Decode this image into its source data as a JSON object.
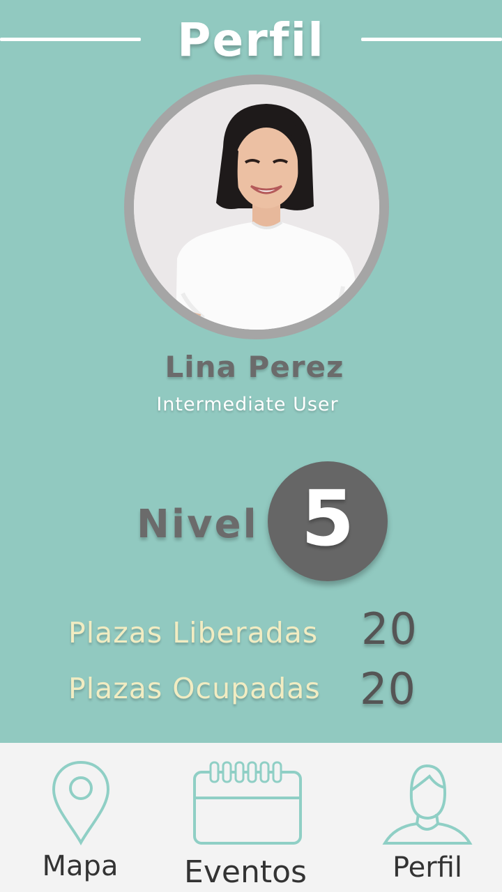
{
  "header": {
    "title": "Perfil"
  },
  "profile": {
    "name": "Lina Perez",
    "role": "Intermediate User"
  },
  "level": {
    "label": "Nivel",
    "value": "5"
  },
  "stats": [
    {
      "label": "Plazas Liberadas",
      "value": "20"
    },
    {
      "label": "Plazas Ocupadas",
      "value": "20"
    }
  ],
  "nav": {
    "items": [
      {
        "label": "Mapa",
        "icon": "map-pin-icon"
      },
      {
        "label": "Eventos",
        "icon": "calendar-icon"
      },
      {
        "label": "Perfil",
        "icon": "user-icon"
      }
    ]
  },
  "colors": {
    "background": "#91c9c0",
    "nav_background": "#f3f3f3",
    "icon_stroke": "#8fcfc5",
    "accent_text": "#f1ecc2",
    "level_badge": "#666666"
  }
}
